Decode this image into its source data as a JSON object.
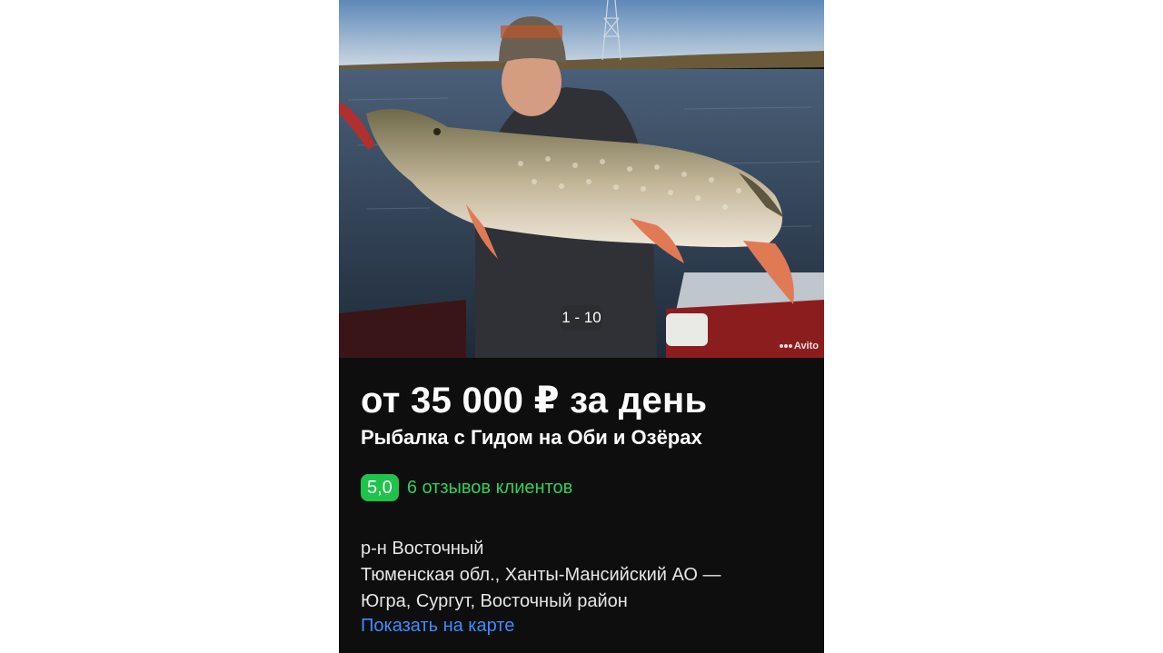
{
  "listing": {
    "photo_counter": "1 - 10",
    "watermark": "Avito",
    "price": "от 35 000 ₽ за день",
    "title": "Рыбалка с Гидом на Оби и Озёрах",
    "rating": "5,0",
    "reviews_link": "6 отзывов клиентов",
    "address_lines": [
      "р-н Восточный",
      "Тюменская обл., Ханты-Мансийский АО —",
      "Югра, Сургут, Восточный район"
    ],
    "map_link": "Показать на карте"
  },
  "colors": {
    "card_bg": "#0e0e0e",
    "rating_green": "#1fc24a",
    "reviews_green": "#2fd15a",
    "link_blue": "#3d8bff"
  }
}
